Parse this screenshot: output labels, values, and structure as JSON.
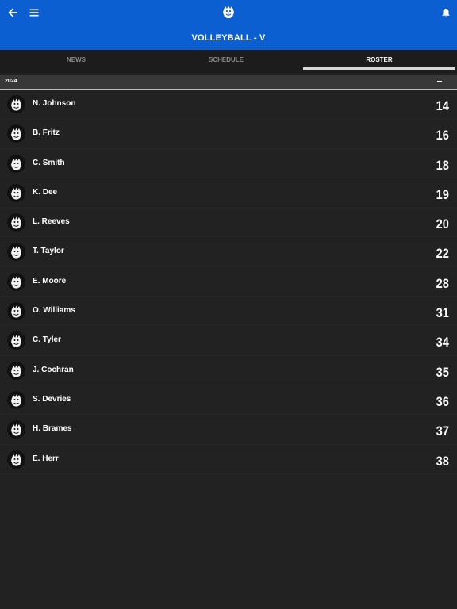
{
  "header": {
    "title": "VOLLEYBALL - V",
    "background_color": "#0c5fd0",
    "back_icon": "arrow-left-icon",
    "menu_icon": "hamburger-menu-icon",
    "logo_icon": "bulldog-logo-icon",
    "notification_icon": "bell-icon"
  },
  "tabs": [
    {
      "label": "NEWS",
      "active": false
    },
    {
      "label": "SCHEDULE",
      "active": false
    },
    {
      "label": "ROSTER",
      "active": true
    }
  ],
  "roster": {
    "season_label": "2024",
    "collapse_icon": "minus-icon",
    "players": [
      {
        "name": "N. Johnson",
        "number": "14"
      },
      {
        "name": "B. Fritz",
        "number": "16"
      },
      {
        "name": "C. Smith",
        "number": "18"
      },
      {
        "name": "K. Dee",
        "number": "19"
      },
      {
        "name": "L. Reeves",
        "number": "20"
      },
      {
        "name": "T. Taylor",
        "number": "22"
      },
      {
        "name": "E. Moore",
        "number": "28"
      },
      {
        "name": "O. Williams",
        "number": "31"
      },
      {
        "name": "C. Tyler",
        "number": "34"
      },
      {
        "name": "J. Cochran",
        "number": "35"
      },
      {
        "name": "S. Devries",
        "number": "36"
      },
      {
        "name": "H. Brames",
        "number": "37"
      },
      {
        "name": "E. Herr",
        "number": "38"
      }
    ]
  }
}
